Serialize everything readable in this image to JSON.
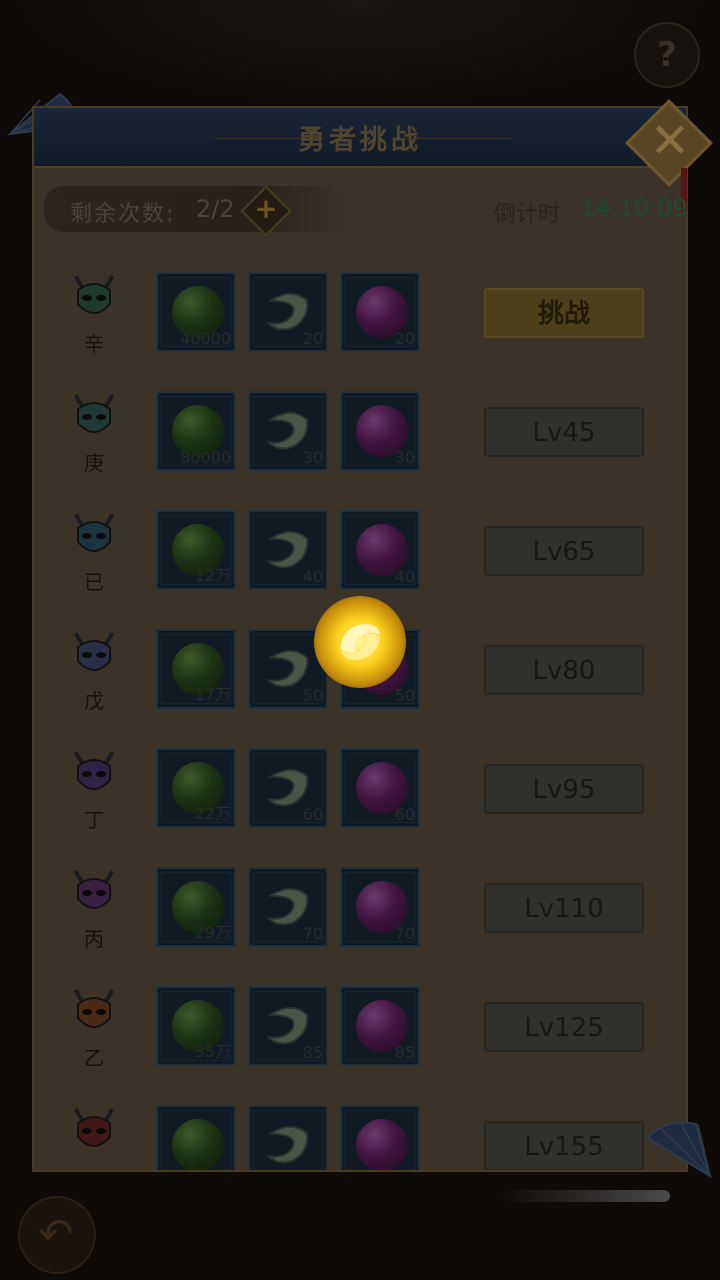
{
  "header": {
    "title": "勇者挑战",
    "help_label": "?",
    "close_label": "✕"
  },
  "status": {
    "remaining_label": "剩余次数:",
    "remaining_count": "2/2",
    "add_label": "+",
    "countdown_label": "倒计时",
    "countdown_value": "14:10:09"
  },
  "rows": [
    {
      "boss": "辛",
      "rewards": [
        "40000",
        "20",
        "20"
      ],
      "button": "挑战",
      "active": true
    },
    {
      "boss": "庚",
      "rewards": [
        "80000",
        "30",
        "30"
      ],
      "button": "Lv45",
      "active": false
    },
    {
      "boss": "已",
      "rewards": [
        "12万",
        "40",
        "40"
      ],
      "button": "Lv65",
      "active": false
    },
    {
      "boss": "戊",
      "rewards": [
        "17万",
        "50",
        "50"
      ],
      "button": "Lv80",
      "active": false
    },
    {
      "boss": "丁",
      "rewards": [
        "22万",
        "60",
        "60"
      ],
      "button": "Lv95",
      "active": false
    },
    {
      "boss": "丙",
      "rewards": [
        "29万",
        "70",
        "70"
      ],
      "button": "Lv110",
      "active": false
    },
    {
      "boss": "乙",
      "rewards": [
        "35万",
        "85",
        "85"
      ],
      "button": "Lv125",
      "active": false
    },
    {
      "boss": "",
      "rewards": [
        "",
        "",
        ""
      ],
      "button": "Lv155",
      "active": false
    }
  ],
  "reward_icons": [
    "green-orb-icon",
    "jade-crescent-icon",
    "purple-orb-icon"
  ],
  "colors": {
    "countdown": "#1d4a32",
    "glow": "#ffd21e"
  }
}
